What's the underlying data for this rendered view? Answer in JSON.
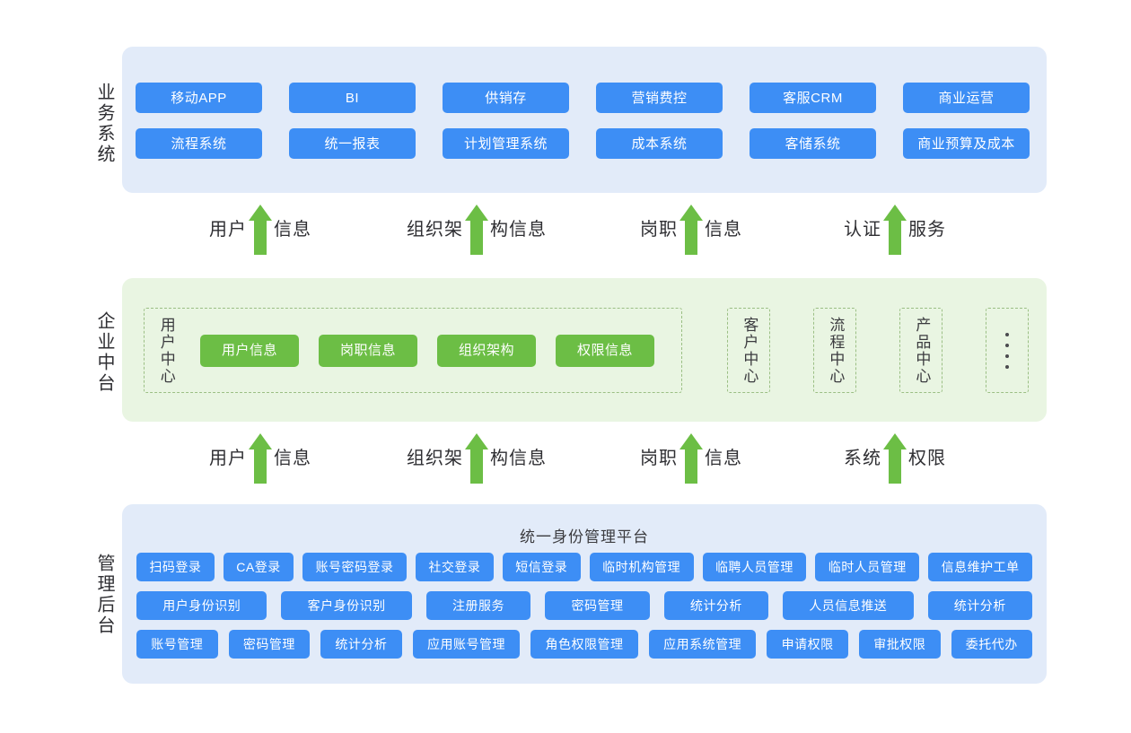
{
  "colors": {
    "blue_chip": "#3d8ef5",
    "blue_panel": "#e2ebf9",
    "green_chip": "#6cbe45",
    "green_panel": "#e9f5e2",
    "arrow_green": "#6cbe45",
    "dashed_border": "#9bbf84",
    "text_dark": "#2f2f33"
  },
  "sections": {
    "business": {
      "side_label": "业务系统",
      "row1": [
        "移动APP",
        "BI",
        "供销存",
        "营销费控",
        "客服CRM",
        "商业运营"
      ],
      "row2": [
        "流程系统",
        "统一报表",
        "计划管理系统",
        "成本系统",
        "客储系统",
        "商业预算及成本"
      ]
    },
    "midplatform": {
      "side_label": "企业中台",
      "user_center": {
        "label": "用户中心",
        "chips": [
          "用户信息",
          "岗职信息",
          "组织架构",
          "权限信息"
        ]
      },
      "other_centers": [
        "客户中心",
        "流程中心",
        "产品中心"
      ],
      "ellipsis_icon": "vertical-ellipsis-icon"
    },
    "admin": {
      "side_label": "管理后台",
      "title": "统一身份管理平台",
      "row1": [
        "扫码登录",
        "CA登录",
        "账号密码登录",
        "社交登录",
        "短信登录",
        "临时机构管理",
        "临聘人员管理",
        "临时人员管理",
        "信息维护工单"
      ],
      "row2": [
        "用户身份识别",
        "客户身份识别",
        "注册服务",
        "密码管理",
        "统计分析",
        "人员信息推送",
        "统计分析"
      ],
      "row3": [
        "账号管理",
        "密码管理",
        "统计分析",
        "应用账号管理",
        "角色权限管理",
        "应用系统管理",
        "申请权限",
        "审批权限",
        "委托代办"
      ]
    }
  },
  "arrows": {
    "upper": [
      {
        "left": "用户",
        "right": "信息",
        "icon": "up-arrow-icon"
      },
      {
        "left": "组织架",
        "right": "构信息",
        "icon": "up-arrow-icon"
      },
      {
        "left": "岗职",
        "right": "信息",
        "icon": "up-arrow-icon"
      },
      {
        "left": "认证",
        "right": "服务",
        "icon": "up-arrow-icon"
      }
    ],
    "lower": [
      {
        "left": "用户",
        "right": "信息",
        "icon": "up-arrow-icon"
      },
      {
        "left": "组织架",
        "right": "构信息",
        "icon": "up-arrow-icon"
      },
      {
        "left": "岗职",
        "right": "信息",
        "icon": "up-arrow-icon"
      },
      {
        "left": "系统",
        "right": "权限",
        "icon": "up-arrow-icon"
      }
    ]
  }
}
